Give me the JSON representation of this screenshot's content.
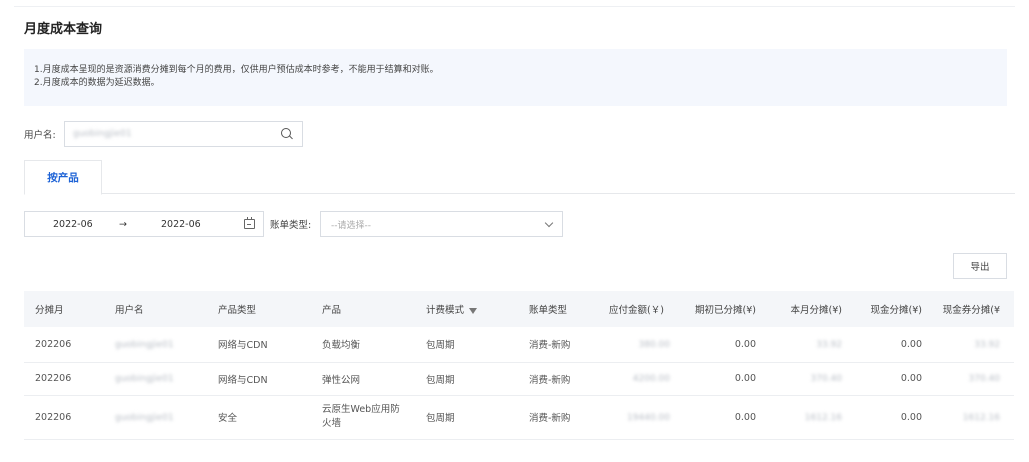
{
  "page": {
    "title": "月度成本查询",
    "notice": [
      "1.月度成本呈现的是资源消费分摊到每个月的费用，仅供用户预估成本时参考，不能用于结算和对账。",
      "2.月度成本的数据为延迟数据。"
    ]
  },
  "user": {
    "label": "用户名:",
    "value": "guobingjie01",
    "search_icon": "search-icon"
  },
  "tabs": [
    {
      "label": "按产品",
      "active": true
    }
  ],
  "filters": {
    "date_start": "2022-06",
    "date_arrow": "→",
    "date_end": "2022-06",
    "calendar_icon": "calendar-icon",
    "bill_type_label": "账单类型:",
    "bill_type_placeholder": "--请选择--",
    "chevron_icon": "chevron-down-icon"
  },
  "export_label": "导出",
  "table": {
    "headers": [
      "分摊月",
      "用户名",
      "产品类型",
      "产品",
      "计费模式",
      "账单类型",
      "应付金额(￥)",
      "期初已分摊(¥)",
      "本月分摊(¥)",
      "现金分摊(¥)",
      "现金券分摊(¥"
    ],
    "rows": [
      [
        "202206",
        "guobingjie01",
        "网络与CDN",
        "负载均衡",
        "包周期",
        "消费-新购",
        "380.00",
        "0.00",
        "33.92",
        "0.00",
        "33.92"
      ],
      [
        "202206",
        "guobingjie01",
        "网络与CDN",
        "弹性公网",
        "包周期",
        "消费-新购",
        "4200.00",
        "0.00",
        "370.40",
        "0.00",
        "370.40"
      ],
      [
        "202206",
        "guobingjie01",
        "安全",
        "云原生Web应用防火墙",
        "包周期",
        "消费-新购",
        "19440.00",
        "0.00",
        "1612.16",
        "0.00",
        "1612.16"
      ]
    ]
  },
  "colors": {
    "accent": "#1e63d6",
    "notice_bg": "#f4f7fd",
    "header_bg": "#f4f6f9"
  }
}
